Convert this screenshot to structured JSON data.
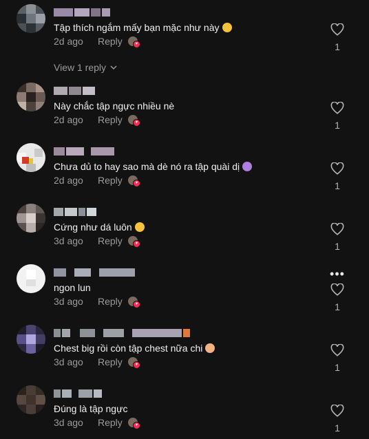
{
  "comments": [
    {
      "text": "Tập thích ngắm mấy bạn mặc như này",
      "emoji": "rolling-laughing-emoji",
      "age": "2d ago",
      "reply_label": "Reply",
      "likes": "1",
      "view_replies": "View 1 reply"
    },
    {
      "text": "Này chắc tập ngực nhiều nè",
      "age": "2d ago",
      "reply_label": "Reply",
      "likes": "1"
    },
    {
      "text": "Chưa dủ to hay sao mà dè nó ra tập quài dị",
      "emoji": "crying-emoji",
      "age": "2d ago",
      "reply_label": "Reply",
      "likes": "1"
    },
    {
      "text": "Cứng như dá luôn",
      "emoji": "grinning-emoji",
      "age": "3d ago",
      "reply_label": "Reply",
      "likes": "1"
    },
    {
      "text": "ngon lun",
      "age": "3d ago",
      "reply_label": "Reply",
      "likes": "1",
      "more": "•••"
    },
    {
      "text": "Chest big rồi còn tập chest nữa chi",
      "emoji": "flushed-emoji",
      "age": "3d ago",
      "reply_label": "Reply",
      "likes": "1"
    },
    {
      "text": "Đúng là tập ngực",
      "age": "3d ago",
      "reply_label": "Reply",
      "likes": "1"
    }
  ],
  "colors": {
    "background": "#121212",
    "text": "#f1f1f1",
    "muted": "#9b9b9b",
    "like_accent": "#fe2c55"
  },
  "icons": {
    "like": "heart-outline-icon",
    "expand": "chevron-down-icon",
    "options": "more-options-icon",
    "liked_by_creator": "creator-liked-badge-icon"
  }
}
